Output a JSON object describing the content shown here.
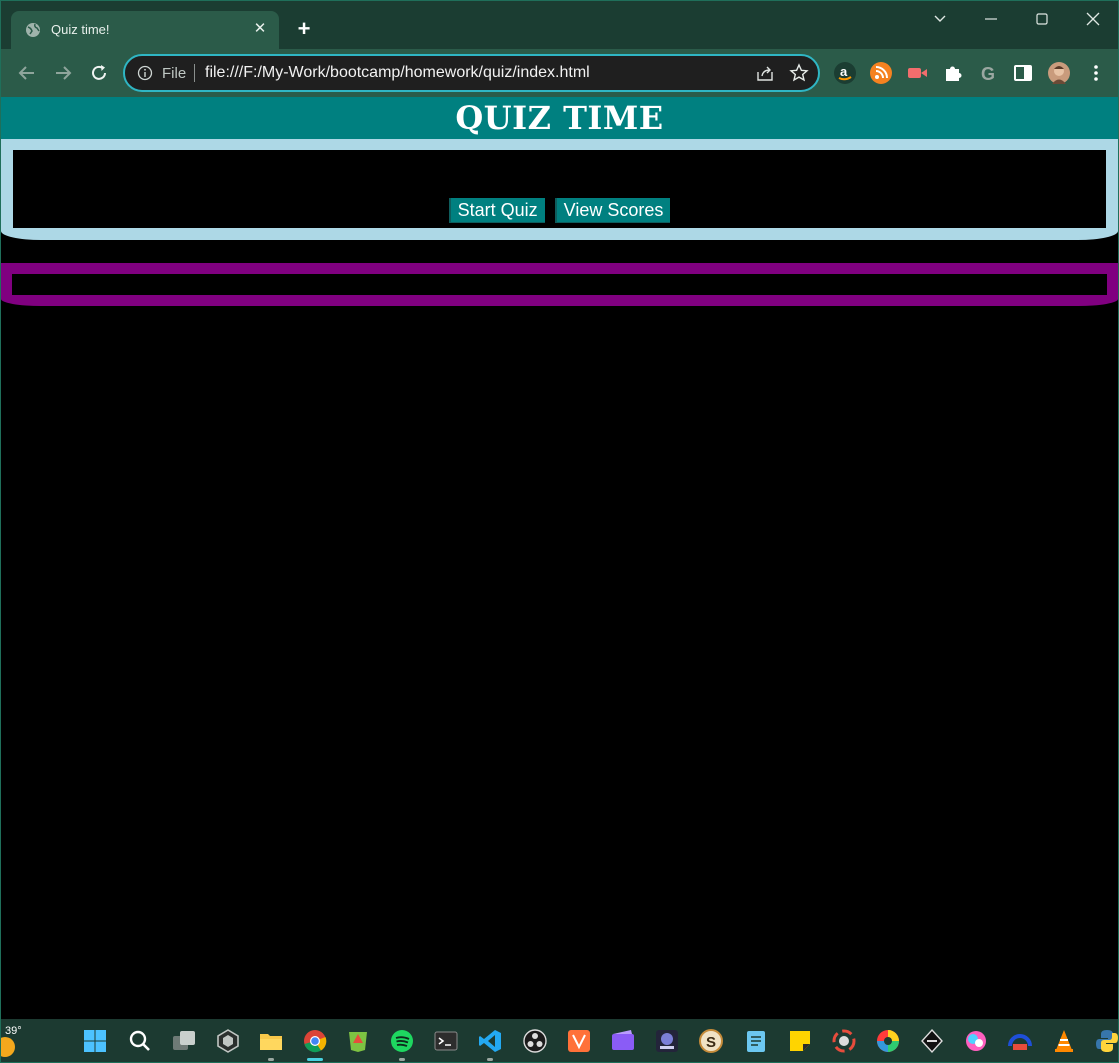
{
  "browser": {
    "tab_title": "Quiz time!",
    "new_tab_symbol": "+",
    "close_symbol": "✕",
    "address": {
      "scheme_label": "File",
      "url": "file:///F:/My-Work/bootcamp/homework/quiz/index.html"
    },
    "extensions": [
      "amazon-icon",
      "rss-icon",
      "screencast-icon",
      "puzzle-icon",
      "grammarly-icon",
      "sidebar-icon",
      "profile-avatar",
      "menu-icon"
    ]
  },
  "page": {
    "title": "QUIZ TIME",
    "buttons": {
      "start_label": "Start Quiz",
      "scores_label": "View Scores"
    },
    "colors": {
      "header": "#008080",
      "quiz_border": "#add8e6",
      "score_border": "#800080",
      "background": "#000000"
    }
  },
  "taskbar": {
    "weather_temp": "39°",
    "apps": [
      "start-icon",
      "search-icon",
      "task-view-icon",
      "unity-icon",
      "file-explorer-icon",
      "chrome-icon",
      "sourcetree-icon",
      "spotify-icon",
      "terminal-icon",
      "vscode-icon",
      "obs-icon",
      "vectorizer-icon",
      "clipchamp-icon",
      "gaming-icon",
      "sourcetree-s-icon",
      "notepad-icon",
      "sticky-notes-icon",
      "davinci-icon",
      "color-wheel-icon",
      "inkscape-icon",
      "pixel-icon",
      "drive-icon",
      "vlc-icon",
      "python-icon"
    ]
  }
}
